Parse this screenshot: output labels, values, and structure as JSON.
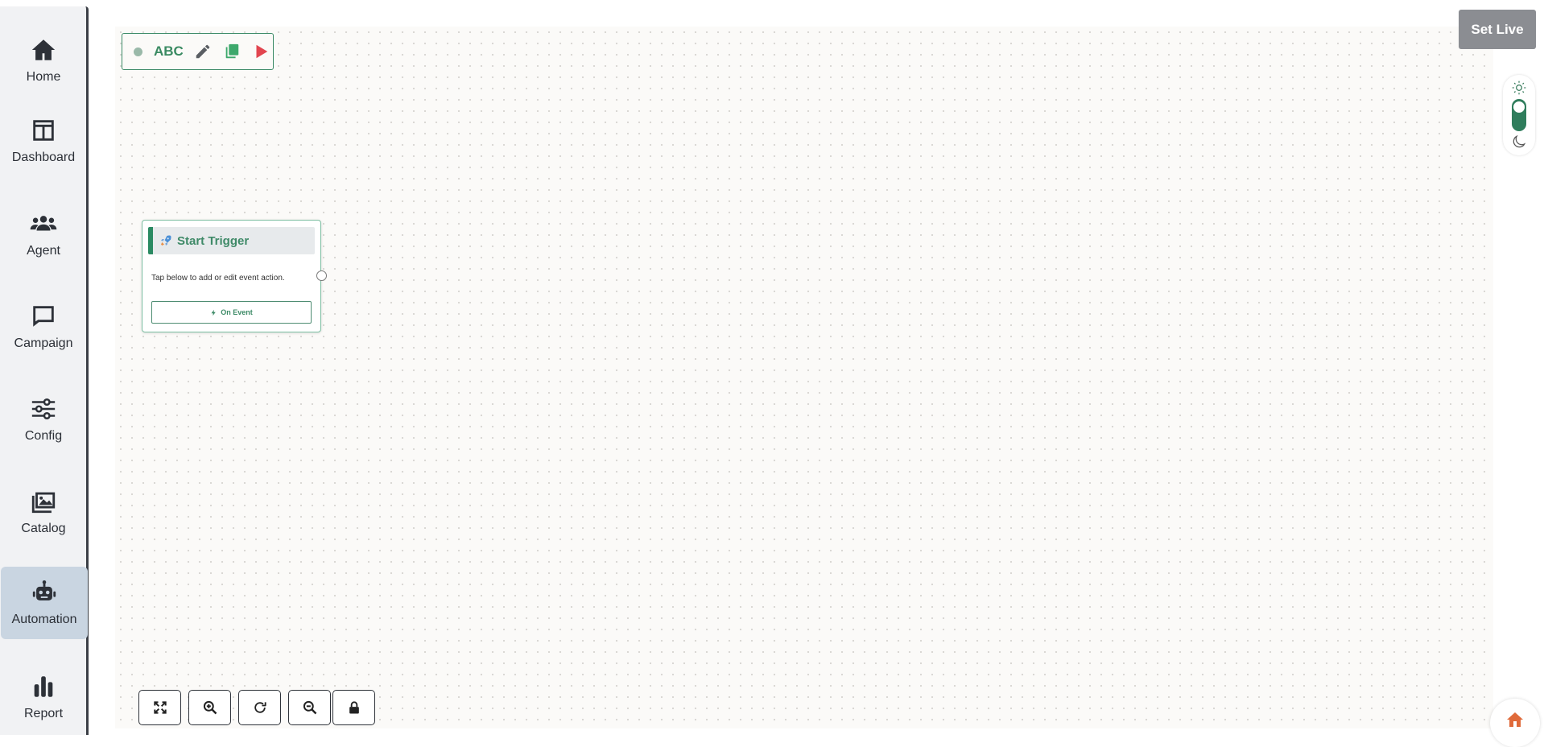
{
  "sidebar": {
    "items": [
      {
        "label": "Home",
        "icon": "home-icon"
      },
      {
        "label": "Dashboard",
        "icon": "dashboard-icon"
      },
      {
        "label": "Agent",
        "icon": "users-icon"
      },
      {
        "label": "Campaign",
        "icon": "chat-icon"
      },
      {
        "label": "Config",
        "icon": "sliders-icon"
      },
      {
        "label": "Catalog",
        "icon": "images-icon"
      },
      {
        "label": "Automation",
        "icon": "robot-icon",
        "active": true
      },
      {
        "label": "Report",
        "icon": "bar-chart-icon"
      }
    ]
  },
  "toolbar": {
    "flow_name": "ABC",
    "status_color": "#9ab9a9",
    "icons": [
      "pencil-icon",
      "copy-icon",
      "play-icon"
    ]
  },
  "header": {
    "set_live_label": "Set Live"
  },
  "theme_toggle": {
    "mode": "light",
    "icons": [
      "sun-icon",
      "moon-icon"
    ]
  },
  "node": {
    "title": "Start Trigger",
    "icon": "rocket-icon",
    "description": "Tap below to add or edit event action.",
    "button_label": "On Event",
    "button_icon": "bolt-icon"
  },
  "zoom_controls": [
    "fit-view-icon",
    "zoom-in-icon",
    "reset-icon",
    "zoom-out-icon",
    "lock-icon"
  ],
  "colors": {
    "accent": "#2f7d5c",
    "set_live_bg": "#8b8d92",
    "play": "#e2454f",
    "sidebar_active": "#c9d5e1"
  }
}
